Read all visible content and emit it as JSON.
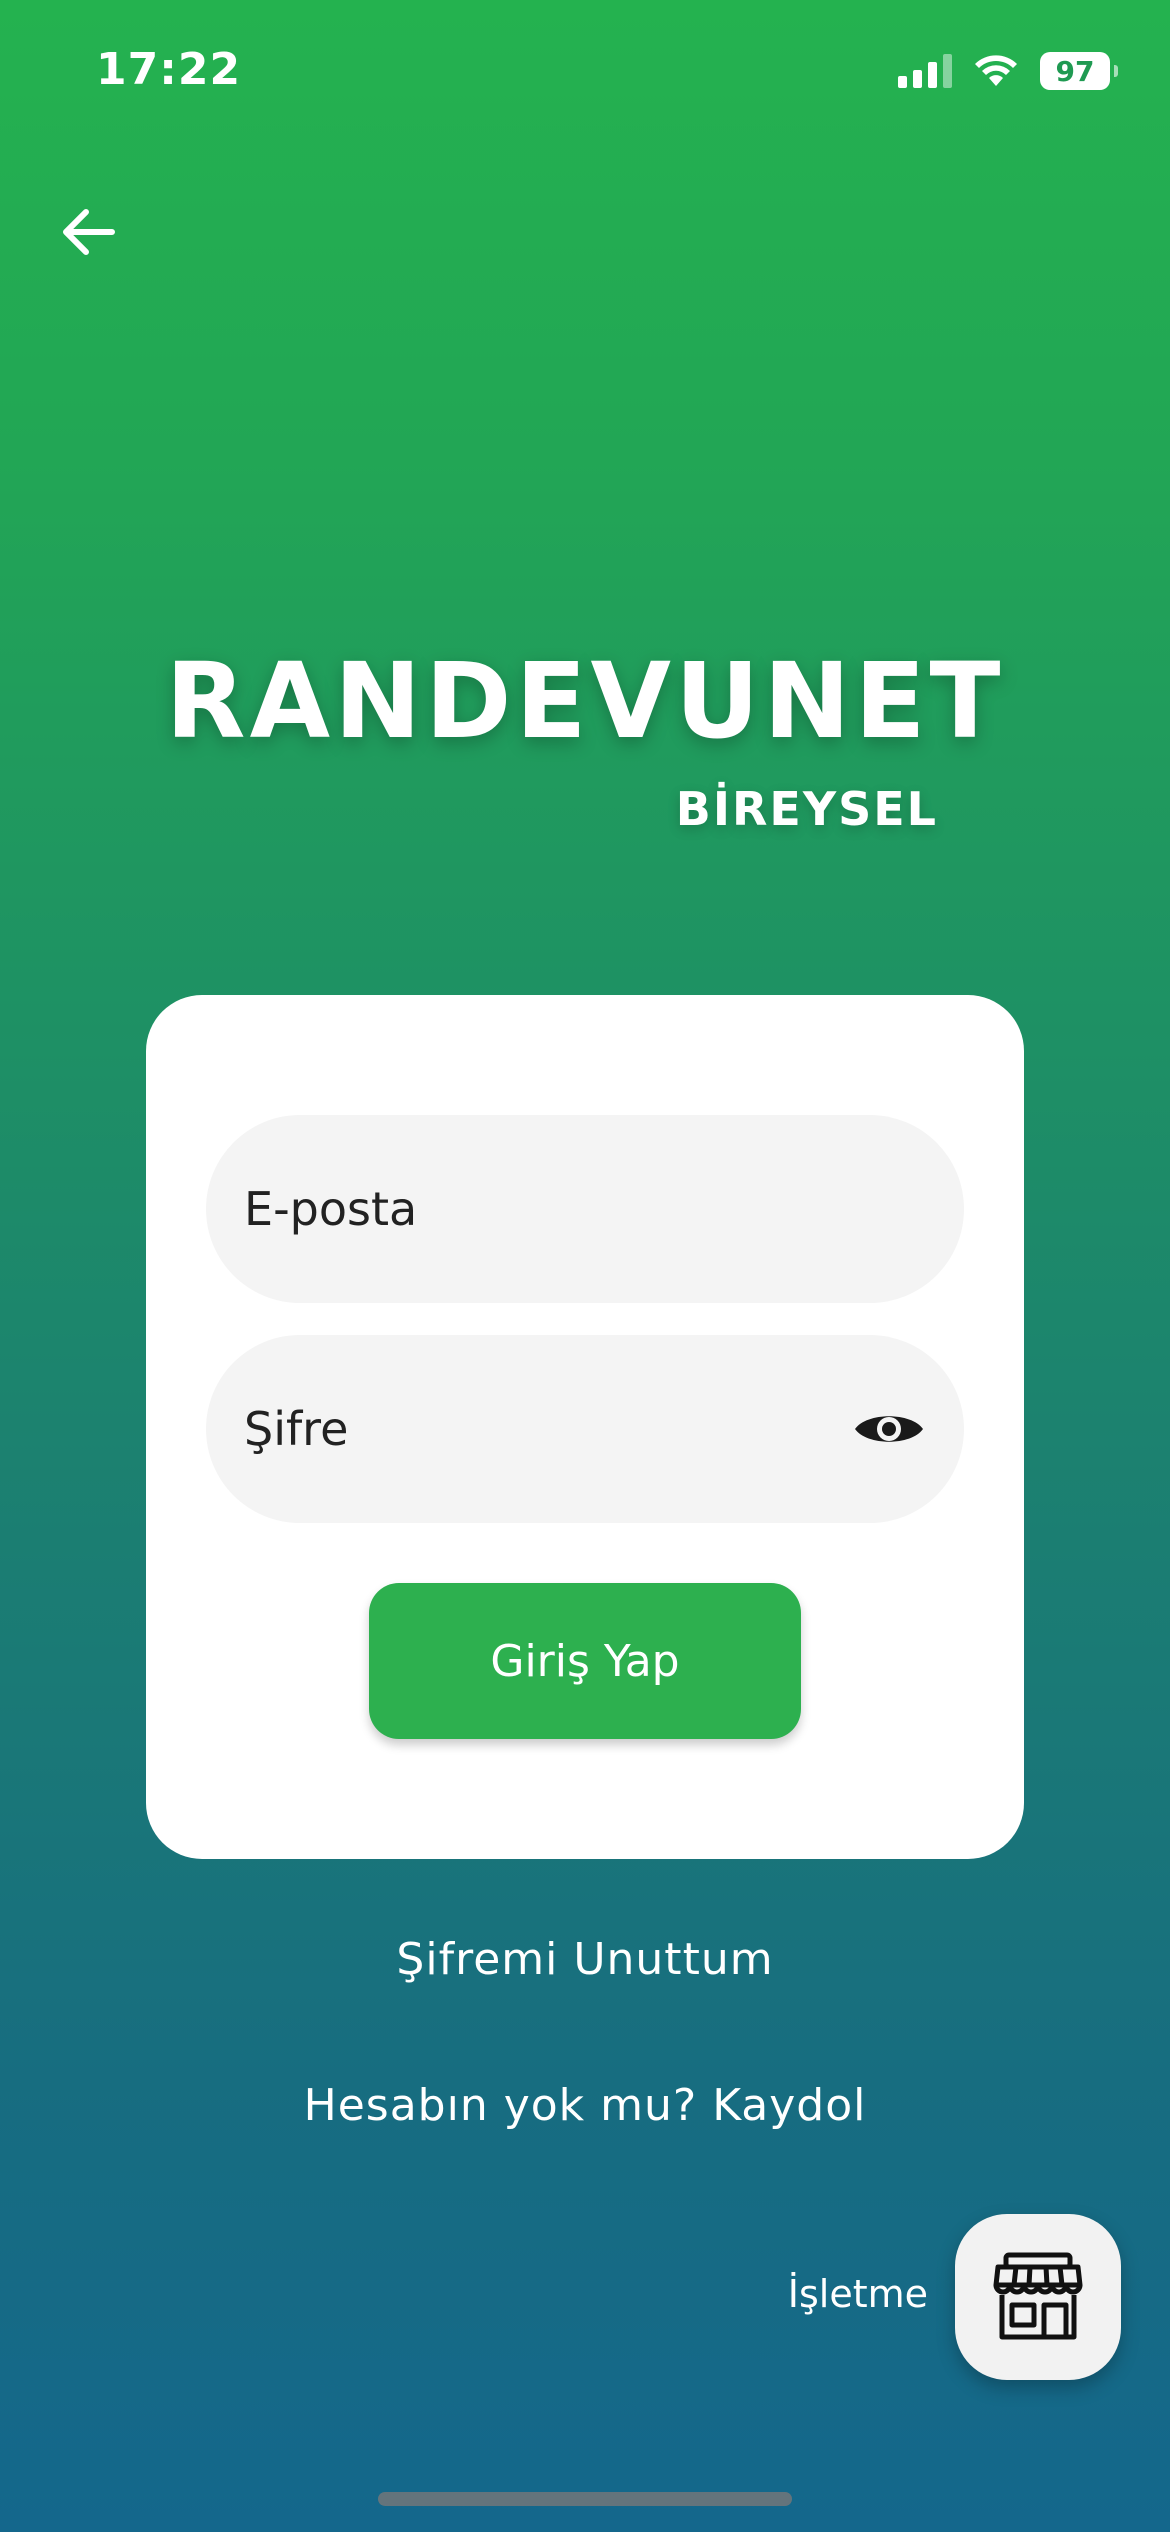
{
  "status_bar": {
    "time": "17:22",
    "battery": "97"
  },
  "icons": {
    "back": "arrow-left-icon",
    "eye": "eye-icon",
    "business": "store-icon",
    "signal": "cellular-signal-icon",
    "wifi": "wifi-icon",
    "battery": "battery-icon"
  },
  "brand": {
    "title": "RANDEVUNET",
    "subtitle": "BİREYSEL"
  },
  "login_form": {
    "email_placeholder": "E-posta",
    "password_placeholder": "Şifre",
    "submit_label": "Giriş Yap"
  },
  "links": {
    "forgot_password": "Şifremi Unuttum",
    "signup": "Hesabın yok mu? Kaydol"
  },
  "business": {
    "label": "İşletme"
  },
  "colors": {
    "accent_green": "#2db04f",
    "gradient_top": "#24b24f",
    "gradient_bottom": "#14678c",
    "card_bg": "#ffffff",
    "input_bg": "#f4f4f4"
  }
}
